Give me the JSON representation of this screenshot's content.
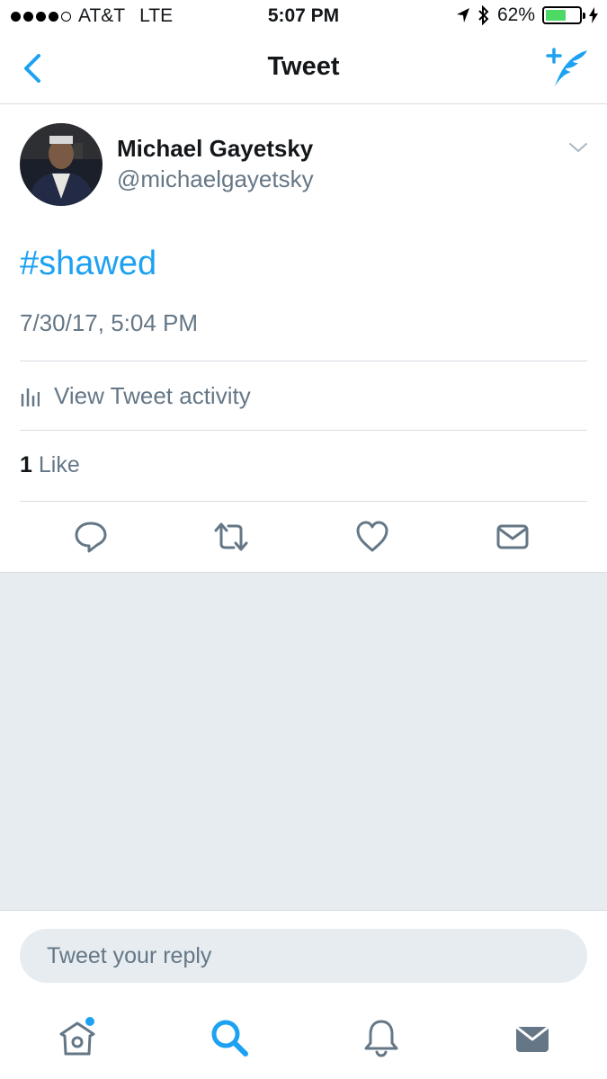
{
  "status_bar": {
    "carrier": "AT&T",
    "network": "LTE",
    "time": "5:07 PM",
    "battery_percent": "62%",
    "battery_level": 0.62,
    "signal_bars": 4,
    "icons": [
      "location-arrow-icon",
      "bluetooth-icon",
      "battery-icon",
      "charging-bolt-icon"
    ]
  },
  "nav": {
    "title": "Tweet",
    "back_icon": "chevron-left-icon",
    "compose_icon": "compose-tweet-icon"
  },
  "tweet": {
    "author_name": "Michael Gayetsky",
    "author_handle": "@michaelgayetsky",
    "text": "#shawed",
    "timestamp": "7/30/17, 5:04 PM",
    "activity_label": "View Tweet activity",
    "like_count": "1",
    "like_label": "Like"
  },
  "actions": [
    "reply-icon",
    "retweet-icon",
    "like-icon",
    "direct-message-icon"
  ],
  "reply": {
    "placeholder": "Tweet your reply"
  },
  "tabs": [
    "home-icon",
    "search-icon",
    "notifications-icon",
    "messages-icon"
  ],
  "colors": {
    "accent": "#1da1f2",
    "secondary_text": "#657786",
    "background_gray": "#e6ecf0"
  }
}
